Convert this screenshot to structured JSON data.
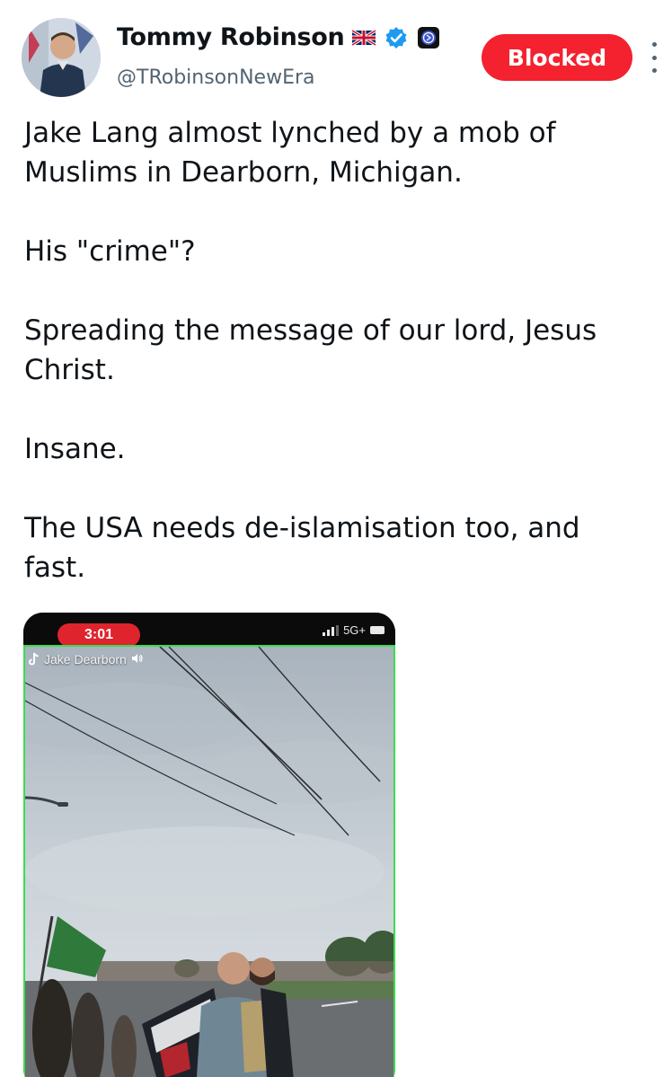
{
  "author": {
    "display_name": "Tommy Robinson",
    "handle": "@TRobinsonNewEra",
    "badges": [
      "uk-flag-icon",
      "verified-check-icon",
      "affiliate-badge-icon"
    ],
    "verified_color": "#1d9bf0"
  },
  "actions": {
    "blocked_label": "Blocked",
    "blocked_color": "#f4212e",
    "more_icon": "more-vertical-icon"
  },
  "tweet": {
    "paragraphs": [
      "Jake Lang almost lynched by a mob of\nMuslims in Dearborn, Michigan.",
      "His \"crime\"?",
      "Spreading the message of our lord, Jesus\nChrist.",
      "Insane.",
      "The USA needs de-islamisation too, and\nfast."
    ]
  },
  "media": {
    "status_time": "3:01",
    "network": "5G+",
    "overlay_label": "Jake Dearborn",
    "overlay_icons": [
      "tiktok-icon",
      "speaker-icon"
    ],
    "frame_color": "#3ddc4f"
  }
}
